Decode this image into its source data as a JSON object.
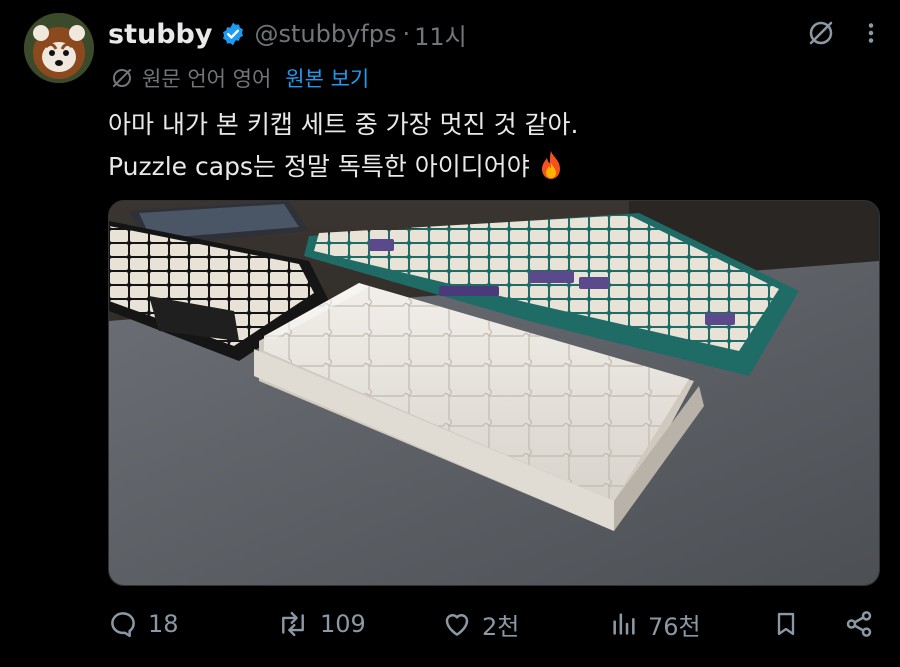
{
  "tweet": {
    "author_name": "stubby",
    "handle": "@stubbyfps",
    "separator": "·",
    "time": "11시",
    "translation_note": "원문 언어 영어",
    "show_original": "원본 보기",
    "text_line1": "아마 내가 본 키캡 세트 중 가장 멋진 것 같아.",
    "text_line2": "Puzzle caps는 정말 독특한 아이디어야",
    "media_alt": "",
    "icons": {
      "verified": "verified-badge-icon",
      "translate": "translate-icon",
      "more": "more-dots-icon",
      "fire": "fire-emoji-icon"
    },
    "colors": {
      "background": "#000000",
      "text": "#e7e9ea",
      "muted": "#71767b",
      "link": "#1d9bf0",
      "verified": "#1d9bf0"
    }
  },
  "actions": {
    "reply_count": "18",
    "repost_count": "109",
    "like_count": "2천",
    "views_count": "76천"
  }
}
